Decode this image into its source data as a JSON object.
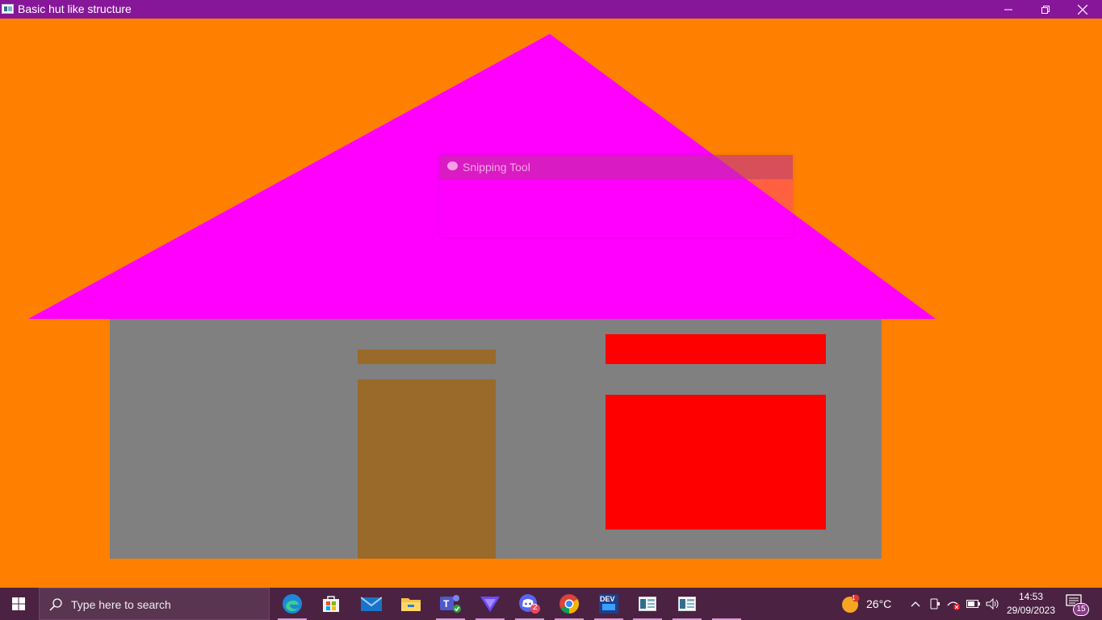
{
  "window": {
    "title": "Basic hut like structure",
    "icon": "window-app-icon",
    "controls": [
      "minimize-icon",
      "restore-icon",
      "close-icon"
    ]
  },
  "scene": {
    "background_color": "#FF8000",
    "roof_color": "#FF00FF",
    "wall_color": "#808080",
    "door_color": "#996A2A",
    "window_color": "#FF0000"
  },
  "snipping_tool": {
    "title": "Snipping Tool",
    "icon": "snipping-tool-icon"
  },
  "taskbar": {
    "search_placeholder": "Type here to search",
    "apps": [
      {
        "name": "edge-icon"
      },
      {
        "name": "microsoft-store-icon"
      },
      {
        "name": "mail-icon"
      },
      {
        "name": "file-explorer-icon"
      },
      {
        "name": "teams-icon"
      },
      {
        "name": "vpn-icon"
      },
      {
        "name": "discord-icon",
        "badge": "2"
      },
      {
        "name": "chrome-icon"
      },
      {
        "name": "dev-cpp-icon",
        "label": "DEV"
      },
      {
        "name": "window-app-icon"
      },
      {
        "name": "window-app-icon"
      }
    ],
    "weather": {
      "temperature": "26°C",
      "badge": "1"
    },
    "clock": {
      "time": "14:53",
      "date": "29/09/2023"
    },
    "notifications_count": "15"
  }
}
